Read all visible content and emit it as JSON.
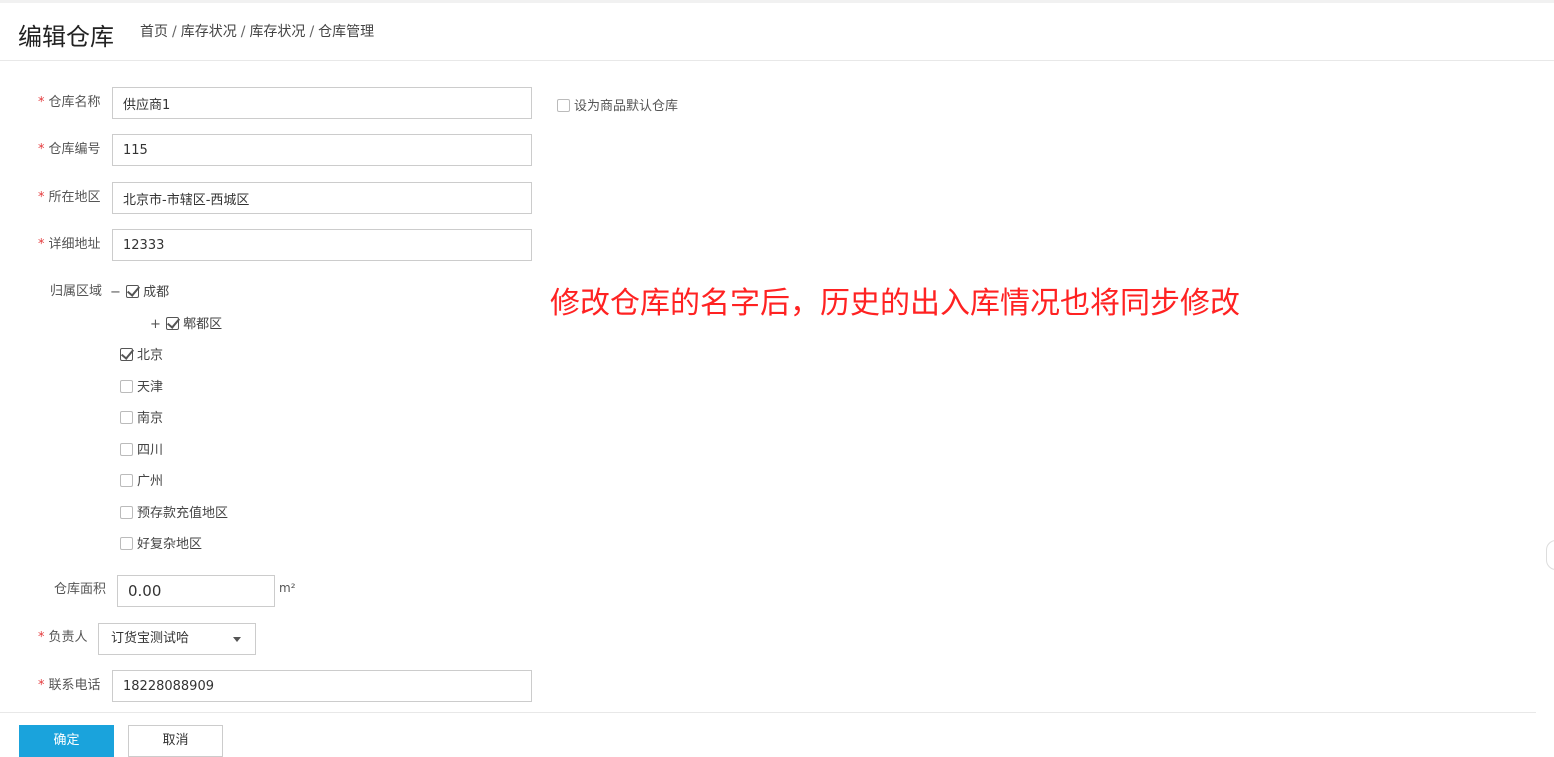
{
  "header": {
    "title": "编辑仓库",
    "breadcrumb": [
      "首页",
      "库存状况",
      "库存状况",
      "仓库管理"
    ]
  },
  "form": {
    "name": {
      "label": "仓库名称",
      "value": "供应商1",
      "required": true
    },
    "default_warehouse": {
      "label": "设为商品默认仓库",
      "checked": false
    },
    "code": {
      "label": "仓库编号",
      "value": "115",
      "required": true
    },
    "region": {
      "label": "所在地区",
      "value": "北京市-市辖区-西城区",
      "required": true
    },
    "address": {
      "label": "详细地址",
      "value": "12333",
      "required": true
    },
    "area_tree": {
      "label": "归属区域",
      "items": [
        {
          "label": "成都",
          "checked": true,
          "toggle": "−"
        },
        {
          "label": "郫都区",
          "checked": true,
          "toggle": "+"
        },
        {
          "label": "北京",
          "checked": true
        },
        {
          "label": "天津",
          "checked": false
        },
        {
          "label": "南京",
          "checked": false
        },
        {
          "label": "四川",
          "checked": false
        },
        {
          "label": "广州",
          "checked": false
        },
        {
          "label": "预存款充值地区",
          "checked": false
        },
        {
          "label": "好复杂地区",
          "checked": false
        }
      ]
    },
    "size": {
      "label": "仓库面积",
      "value": "0.00",
      "unit": "m²"
    },
    "manager": {
      "label": "负责人",
      "value": "订货宝测试哈",
      "required": true
    },
    "phone": {
      "label": "联系电话",
      "value": "18228088909",
      "required": true
    }
  },
  "annotation": "修改仓库的名字后，历史的出入库情况也将同步修改",
  "buttons": {
    "confirm": "确定",
    "cancel": "取消"
  },
  "required_mark": "*",
  "colors": {
    "primary": "#1aa3dc",
    "required": "#e4393c",
    "annotation": "#ff2222"
  }
}
